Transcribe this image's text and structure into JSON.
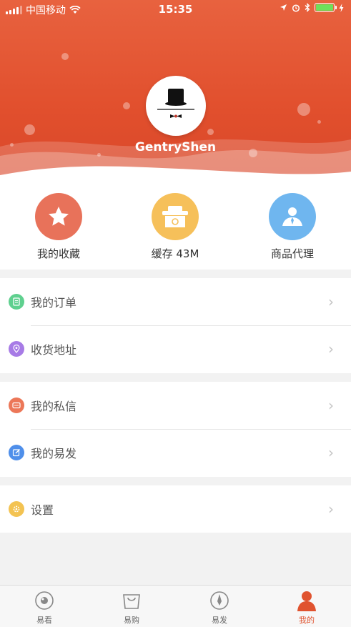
{
  "status_bar": {
    "carrier": "中国移动",
    "time": "15:35"
  },
  "profile": {
    "username": "GentryShen"
  },
  "shortcuts": [
    {
      "label": "我的收藏",
      "icon": "star-icon",
      "color": "#e8725a"
    },
    {
      "label": "缓存 43M",
      "icon": "cache-box-icon",
      "color": "#f6c05a"
    },
    {
      "label": "商品代理",
      "icon": "agent-person-icon",
      "color": "#6fb6ef"
    }
  ],
  "menu": {
    "orders": {
      "label": "我的订单",
      "icon": "clipboard-icon",
      "color": "#5fd08f"
    },
    "address": {
      "label": "收货地址",
      "icon": "location-pin-icon",
      "color": "#a77be6"
    },
    "messages": {
      "label": "我的私信",
      "icon": "message-icon",
      "color": "#ec7758"
    },
    "my_posts": {
      "label": "我的易发",
      "icon": "edit-icon",
      "color": "#4f8fea"
    },
    "settings": {
      "label": "设置",
      "icon": "gear-icon",
      "color": "#f3c352"
    }
  },
  "tabbar": [
    {
      "label": "易看",
      "icon": "eye-icon",
      "active": false
    },
    {
      "label": "易购",
      "icon": "shopping-bag-icon",
      "active": false
    },
    {
      "label": "易发",
      "icon": "compass-icon",
      "active": false
    },
    {
      "label": "我的",
      "icon": "person-icon",
      "active": true
    }
  ],
  "colors": {
    "header": "#e14f2d",
    "active_tab": "#e0532f"
  }
}
